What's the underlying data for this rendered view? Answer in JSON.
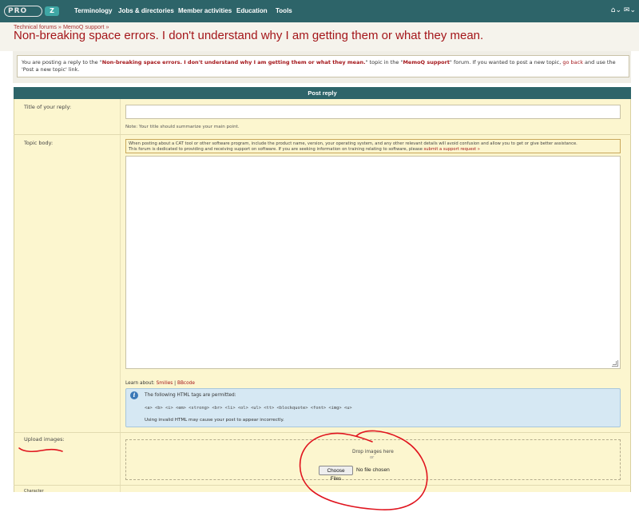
{
  "nav": {
    "logo_text": "PRO",
    "logo_badge": "Z",
    "items": [
      "Terminology",
      "Jobs & directories",
      "Member activities",
      "Education",
      "Tools"
    ],
    "icons": [
      "home-icon",
      "mail-icon"
    ],
    "icon_glyphs": "⌂⌄ ✉⌄"
  },
  "breadcrumb": {
    "item1": "Technical forums",
    "sep": " » ",
    "item2": "MemoQ support",
    "trail": " »"
  },
  "page_title": "Non-breaking space errors. I don't understand why I am getting them or what they mean.",
  "notice": {
    "prefix": "You are posting a reply to the \"",
    "topic": "Non-breaking space errors. I don't understand why I am getting them or what they mean.",
    "mid": "\" topic in the \"",
    "forum": "MemoQ support",
    "mid2": "\" forum. If you wanted to post a new topic, ",
    "link": "go back",
    "suffix": " and use the 'Post a new topic' link."
  },
  "form": {
    "header": "Post reply",
    "title_label": "Title of your reply:",
    "title_value": "",
    "title_note": "Note: Your title should summarize your main point.",
    "body_label": "Topic body:",
    "body_note_line1": "When posting about a CAT tool or other software program, include the product name, version, your operating system, and any other relevant details will avoid confusion and allow you to get or give better assistance.",
    "body_note_line2_prefix": "This forum is dedicated to providing and receiving support on software. If you are seeking information on training relating to software, please ",
    "body_note_link": "submit a support request »",
    "body_value": "",
    "learn_prefix": "Learn about: ",
    "learn_smilies": "Smilies",
    "learn_sep": " | ",
    "learn_bbcode": "BBcode",
    "info_line1": "The following HTML tags are permitted:",
    "info_tags": "<a> <b> <i> <em> <strong> <br> <li> <ol> <ul> <tt> <blockquote> <font> <img> <u>",
    "info_line3": "Using invalid HTML may cause your post to appear incorrectly.",
    "upload_label": "Upload images:",
    "drop_text": "Drop images here",
    "drop_or": "or",
    "choose_button": "Choose Files",
    "file_status": "No file chosen",
    "next_label": "Character"
  },
  "colors": {
    "nav_bg": "#2d6469",
    "title_red": "#a4161a",
    "form_bg": "#fcf6cf",
    "info_bg": "#d6e8f3",
    "annotation": "#e0141e"
  }
}
